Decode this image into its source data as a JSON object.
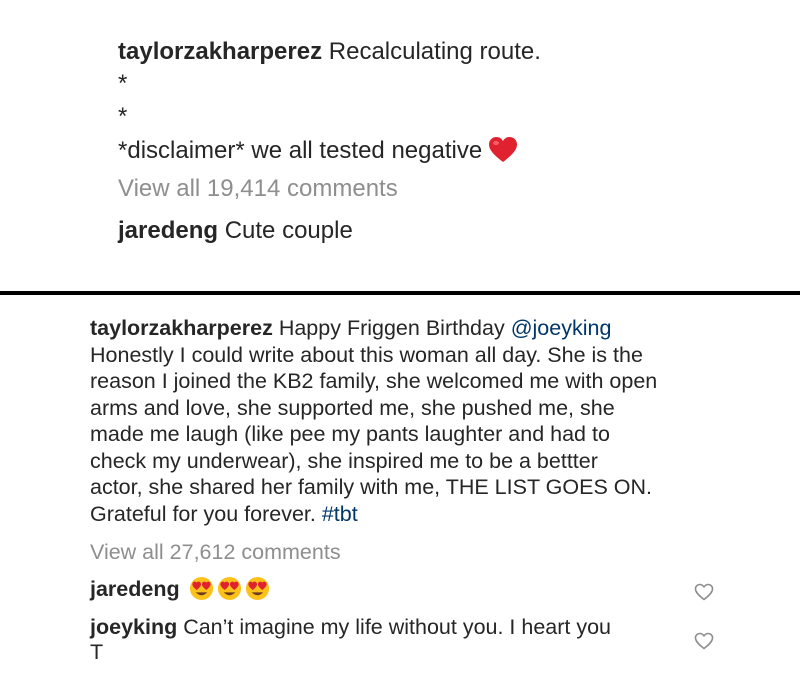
{
  "top_post": {
    "caption": {
      "username": "taylorzakharperez",
      "text_line1": "Recalculating route.",
      "star1": "*",
      "star2": "*",
      "text_line4": "*disclaimer* we all tested negative",
      "emoji": "red-heart"
    },
    "view_all": "View all 19,414 comments",
    "comment": {
      "username": "jaredeng",
      "text": "Cute couple"
    }
  },
  "bottom_post": {
    "caption": {
      "username": "taylorzakharperez",
      "line1_text": "Happy Friggen Birthday",
      "mention": "@joeyking",
      "lines": [
        "Honestly I could write about this woman all day. She is the",
        "reason I joined the KB2 family, she welcomed me with open",
        "arms and love, she supported me, she pushed me, she",
        "made me laugh (like pee my pants laughter and had to",
        "check my underwear), she inspired me to be a bettter",
        "actor, she shared her family with me, THE LIST GOES ON."
      ],
      "last_line_text": "Grateful for you forever.",
      "hashtag": "#tbt"
    },
    "view_all": "View all 27,612 comments",
    "comments": [
      {
        "username": "jaredeng",
        "text": "",
        "emojis": [
          "heart-eyes",
          "heart-eyes",
          "heart-eyes"
        ]
      },
      {
        "username": "joeyking",
        "text": "Can’t imagine my life without you. I heart you",
        "text_cont": "T"
      }
    ]
  },
  "colors": {
    "text": "#262626",
    "muted": "#8e8e8e",
    "link": "#00376b",
    "heart": "#e0212f",
    "divider": "#000000"
  },
  "icons": [
    "heart-emoji",
    "heart-eyes-emoji",
    "like-heart-icon"
  ]
}
